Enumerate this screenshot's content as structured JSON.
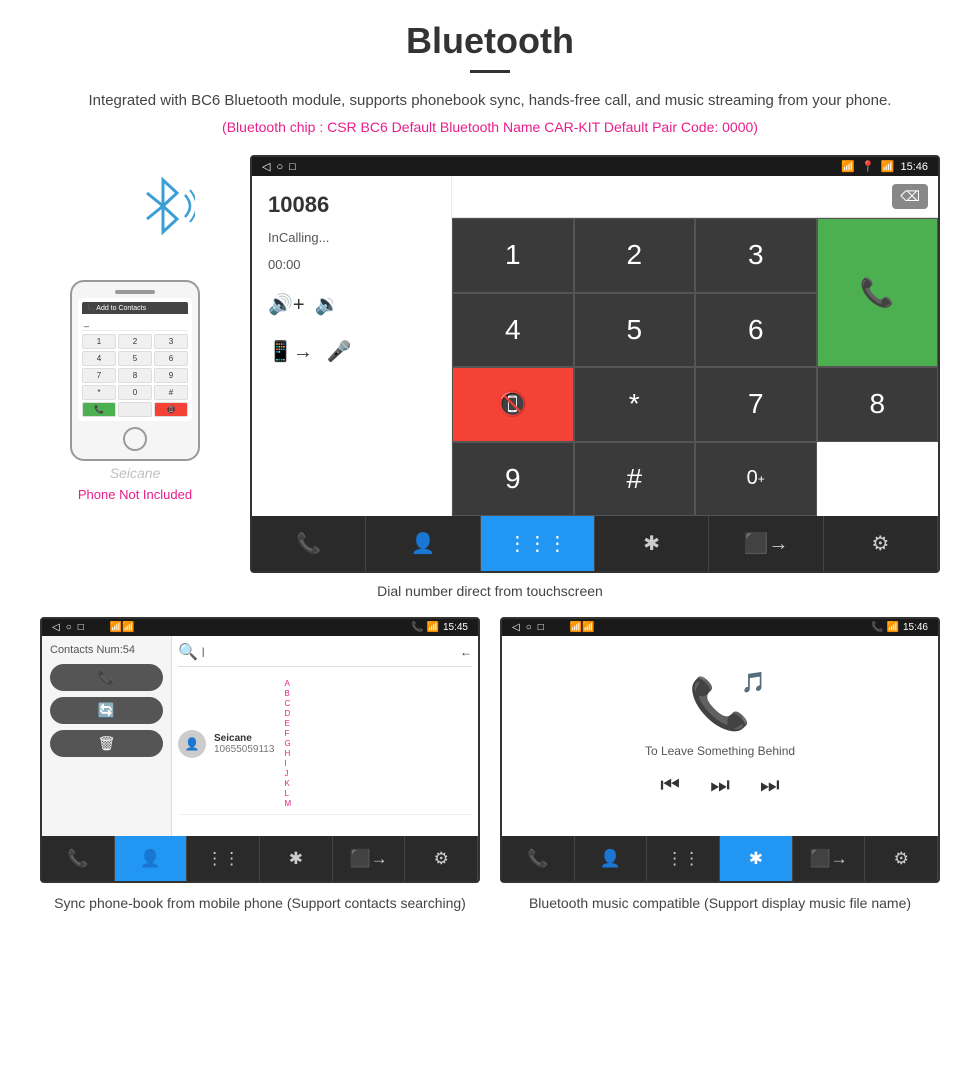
{
  "page": {
    "title": "Bluetooth",
    "subtitle": "Integrated with BC6 Bluetooth module, supports phonebook sync, hands-free call, and music streaming from your phone.",
    "bluetooth_info": "(Bluetooth chip : CSR BC6    Default Bluetooth Name CAR-KIT    Default Pair Code: 0000)",
    "phone_not_included": "Phone Not Included",
    "caption_main": "Dial number direct from touchscreen",
    "caption_contacts": "Sync phone-book from mobile phone\n(Support contacts searching)",
    "caption_music": "Bluetooth music compatible\n(Support display music file name)"
  },
  "car_screen": {
    "status_bar": {
      "time": "15:46",
      "back_icon": "◁",
      "home_icon": "○",
      "recent_icon": "□"
    },
    "call": {
      "number": "10086",
      "status": "InCalling...",
      "timer": "00:00"
    },
    "dialpad": {
      "keys": [
        "1",
        "2",
        "3",
        "*",
        "4",
        "5",
        "6",
        "0+",
        "7",
        "8",
        "9",
        "#"
      ]
    },
    "nav_items": [
      "📞",
      "👤",
      "⋮⋮⋮",
      "✱",
      "⬛",
      "⚙"
    ]
  },
  "contacts_screen": {
    "status_time": "15:45",
    "contacts_num": "Contacts Num:54",
    "contact_name": "Seicane",
    "contact_phone": "10655059113",
    "nav_active": 1
  },
  "music_screen": {
    "status_time": "15:46",
    "song_title": "To Leave Something Behind",
    "nav_active": 3
  }
}
